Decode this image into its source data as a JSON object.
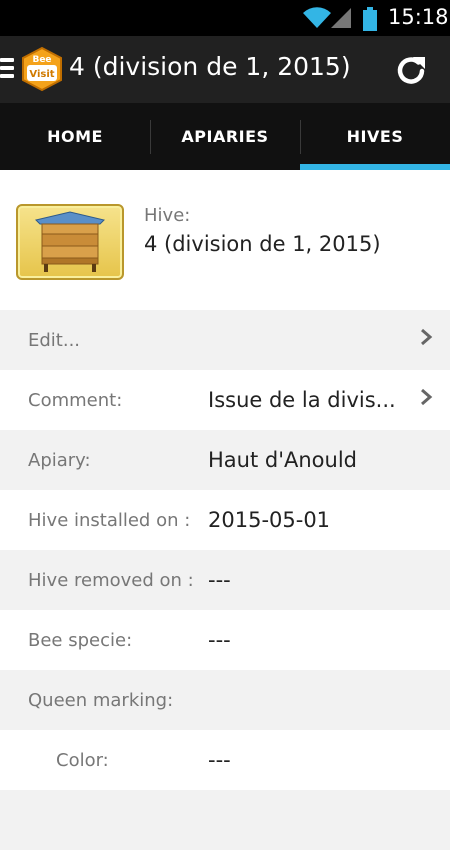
{
  "status_bar": {
    "time": "15:18",
    "icons": [
      "wifi-icon",
      "signal-icon",
      "battery-icon"
    ]
  },
  "action_bar": {
    "logo_text_top": "Bee",
    "logo_text_bottom": "Visit",
    "title": "4 (division de 1, 2015)",
    "icons": [
      "menu-icon",
      "refresh-icon"
    ]
  },
  "tabs": [
    {
      "label": "HOME",
      "active": false
    },
    {
      "label": "APIARIES",
      "active": false
    },
    {
      "label": "HIVES",
      "active": true
    }
  ],
  "header": {
    "label": "Hive:",
    "name": "4 (division de 1, 2015)"
  },
  "rows": [
    {
      "label": "Edit...",
      "value": "",
      "chevron": true
    },
    {
      "label": "Comment:",
      "value": "Issue de la divis...",
      "chevron": true
    },
    {
      "label": "Apiary:",
      "value": "Haut d'Anould",
      "chevron": false
    },
    {
      "label": "Hive installed on :",
      "value": "2015-05-01",
      "chevron": false
    },
    {
      "label": "Hive removed on :",
      "value": "---",
      "chevron": false
    },
    {
      "label": "Bee specie:",
      "value": "---",
      "chevron": false
    },
    {
      "label": "Queen marking:",
      "value": "",
      "chevron": false
    },
    {
      "label": "Color:",
      "value": "---",
      "chevron": false
    }
  ],
  "colors": {
    "accent": "#33b5e5",
    "action_bar": "#212121",
    "tab_bar": "#111111"
  }
}
